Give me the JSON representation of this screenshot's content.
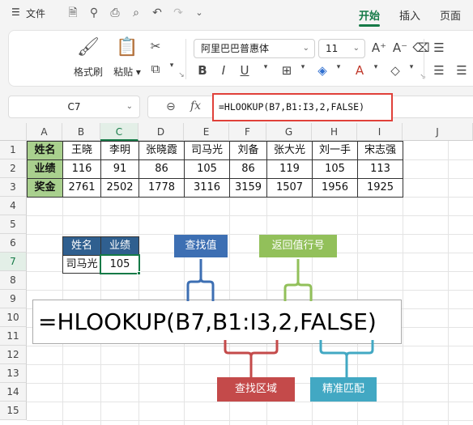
{
  "menubar": {
    "menu_icon": "☰",
    "file_label": "文件",
    "tabs": [
      "开始",
      "插入",
      "页面"
    ]
  },
  "ribbon": {
    "format_painter": "格式刷",
    "paste": "粘贴",
    "font_name": "阿里巴巴普惠体",
    "font_size": "11",
    "bold": "B",
    "italic": "I",
    "underline": "U"
  },
  "formula_bar": {
    "name_box": "C7",
    "fx": "fx",
    "formula": "=HLOOKUP(B7,B1:I3,2,FALSE)"
  },
  "sheet": {
    "columns": [
      "A",
      "B",
      "C",
      "D",
      "E",
      "F",
      "G",
      "H",
      "I",
      "J"
    ],
    "rows": [
      "1",
      "2",
      "3",
      "4",
      "5",
      "6",
      "7",
      "8",
      "9",
      "10",
      "11",
      "12",
      "13",
      "14",
      "15"
    ],
    "table": {
      "row_labels": [
        "姓名",
        "业绩",
        "奖金"
      ],
      "names": [
        "王晓",
        "李明",
        "张晓霞",
        "司马光",
        "刘备",
        "张大光",
        "刘一手",
        "宋志强"
      ],
      "performance": [
        "116",
        "91",
        "86",
        "105",
        "86",
        "119",
        "105",
        "113"
      ],
      "bonus": [
        "2761",
        "2502",
        "1778",
        "3116",
        "3159",
        "1507",
        "1956",
        "1925"
      ]
    },
    "lookup": {
      "header_name": "姓名",
      "header_perf": "业绩",
      "name_value": "司马光",
      "result_value": "105"
    }
  },
  "annotations": {
    "big_formula": "=HLOOKUP(B7,B1:I3,2,FALSE)",
    "lookup_value": "查找值",
    "row_index": "返回值行号",
    "lookup_range": "查找区域",
    "exact_match": "精准匹配"
  },
  "colors": {
    "accent_green": "#157a47",
    "label_green": "#a9d08e",
    "header_blue": "#2f5f8f",
    "callout_blue": "#3d6fb3",
    "callout_green": "#92c05a",
    "callout_red": "#c44a4a",
    "callout_teal": "#42a8c3",
    "highlight_red": "#e0413a"
  }
}
